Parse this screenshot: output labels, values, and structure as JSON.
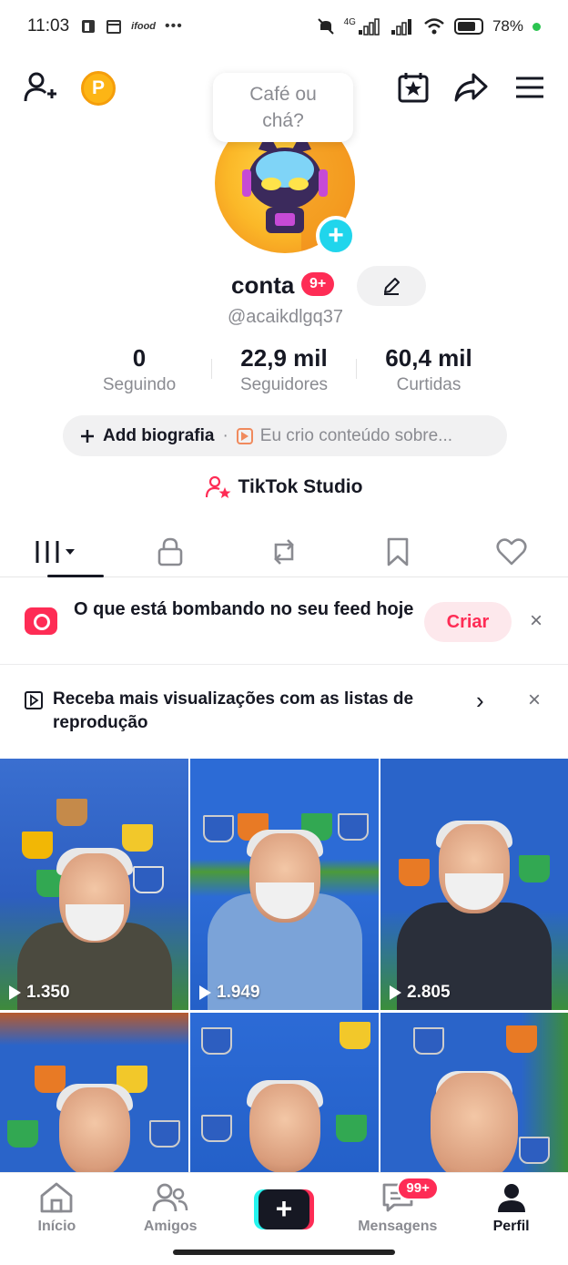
{
  "status_bar": {
    "time": "11:03",
    "left_icons": [
      "notification-icon",
      "calendar-icon",
      "ifood-icon"
    ],
    "more": "•••",
    "network": "4G",
    "battery": "78%"
  },
  "top_bar": {
    "add_friend_icon": "add-person-icon",
    "coin_label": "P",
    "calendar_icon": "calendar-star-icon",
    "share_icon": "share-icon",
    "menu_icon": "menu-icon"
  },
  "bubble": {
    "line1": "Café ou",
    "line2": "chá?"
  },
  "profile": {
    "name": "conta",
    "name_badge": "9+",
    "handle": "@acaikdlgq37"
  },
  "stats": [
    {
      "value": "0",
      "label": "Seguindo"
    },
    {
      "value": "22,9 mil",
      "label": "Seguidores"
    },
    {
      "value": "60,4 mil",
      "label": "Curtidas"
    }
  ],
  "bio": {
    "add_label": "Add biografia",
    "separator": "·",
    "hint": "Eu crio conteúdo sobre..."
  },
  "studio": {
    "label": "TikTok Studio"
  },
  "tabs": [
    "videos-grid-icon",
    "lock-icon",
    "repost-icon",
    "bookmark-icon",
    "heart-icon"
  ],
  "banner_feed": {
    "text": "O que está bombando no seu feed hoje",
    "button": "Criar",
    "close": "×"
  },
  "banner_playlist": {
    "text": "Receba mais visualizações com as listas de reprodução",
    "chevron": "›",
    "close": "×"
  },
  "videos": [
    {
      "views": "1.350"
    },
    {
      "views": "1.949"
    },
    {
      "views": "2.805"
    },
    {
      "views": ""
    },
    {
      "views": ""
    },
    {
      "views": ""
    }
  ],
  "bottom_nav": {
    "home": "Início",
    "friends": "Amigos",
    "create": "+",
    "messages": "Mensagens",
    "messages_badge": "99+",
    "profile": "Perfil"
  },
  "colors": {
    "accent": "#fe2c55",
    "cyan": "#25f4ee",
    "text": "#161823",
    "muted": "#8a8b91"
  }
}
